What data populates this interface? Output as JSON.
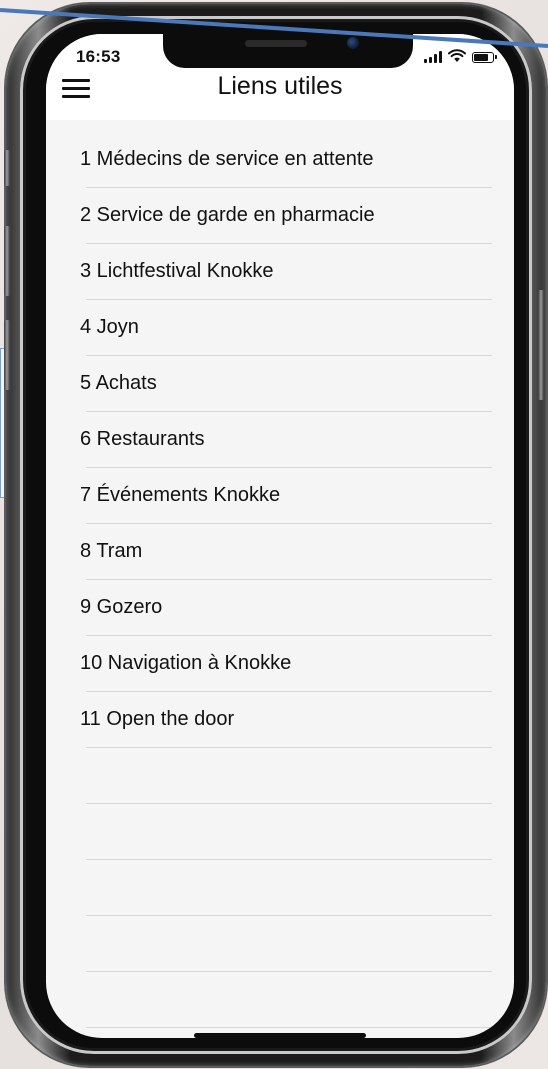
{
  "status_bar": {
    "time": "16:53"
  },
  "header": {
    "title": "Liens utiles",
    "menu_icon": "hamburger-menu-icon"
  },
  "links": [
    {
      "label": "1  Médecins de service en attente"
    },
    {
      "label": "2  Service de garde en pharmacie"
    },
    {
      "label": "3  Lichtfestival Knokke"
    },
    {
      "label": "4  Joyn"
    },
    {
      "label": "5  Achats"
    },
    {
      "label": "6  Restaurants"
    },
    {
      "label": "7  Événements Knokke"
    },
    {
      "label": "8  Tram"
    },
    {
      "label": "9  Gozero"
    },
    {
      "label": "10  Navigation à Knokke"
    },
    {
      "label": "11  Open the door"
    },
    {
      "label": ""
    },
    {
      "label": ""
    },
    {
      "label": ""
    },
    {
      "label": ""
    },
    {
      "label": ""
    }
  ],
  "colors": {
    "overlay_line": "#4a78b8",
    "list_background": "#f5f5f5",
    "header_background": "#ffffff"
  }
}
